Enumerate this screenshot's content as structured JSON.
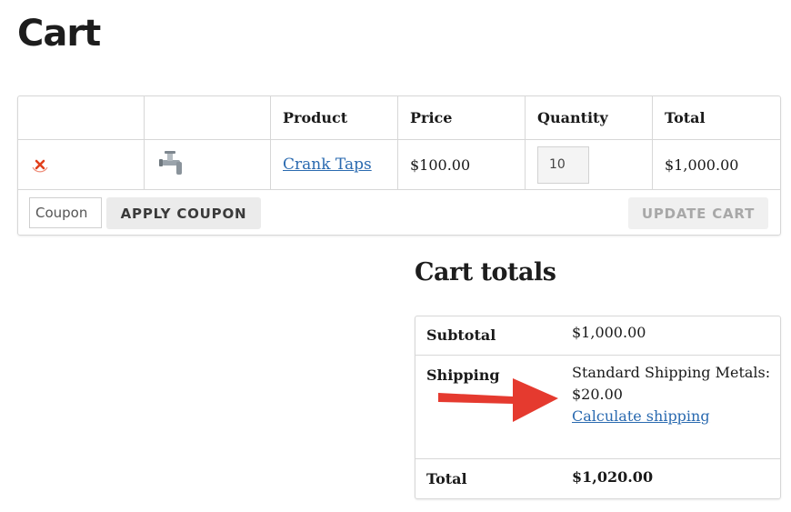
{
  "page": {
    "title": "Cart"
  },
  "cart_table": {
    "headers": [
      "",
      "",
      "Product",
      "Price",
      "Quantity",
      "Total"
    ],
    "items": [
      {
        "remove_icon": "remove-x-icon",
        "thumbnail_icon": "faucet-icon",
        "product": "Crank Taps",
        "price": "$100.00",
        "quantity": "10",
        "total": "$1,000.00"
      }
    ],
    "coupon_placeholder": "Coupon",
    "apply_coupon_label": "APPLY COUPON",
    "update_cart_label": "UPDATE CART"
  },
  "totals": {
    "title": "Cart totals",
    "subtotal_label": "Subtotal",
    "subtotal_value": "$1,000.00",
    "shipping_label": "Shipping",
    "shipping_method": "Standard Shipping Metals:",
    "shipping_price": "$20.00",
    "calculate_shipping_label": "Calculate shipping",
    "total_label": "Total",
    "total_value": "$1,020.00"
  },
  "colors": {
    "link": "#2a6ab0",
    "remove": "#e2401c",
    "annotation_arrow": "#e53a2f"
  }
}
